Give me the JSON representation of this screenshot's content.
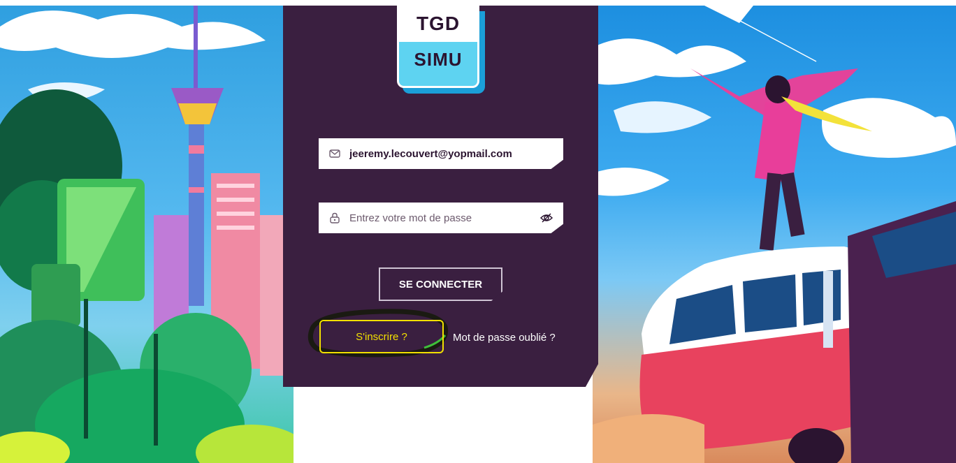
{
  "logo": {
    "top_text": "TGD",
    "brand_text": "SIMU"
  },
  "email_field": {
    "value": "jeeremy.lecouvert@yopmail.com",
    "icon": "mail-icon"
  },
  "password_field": {
    "placeholder": "Entrez votre mot de passe",
    "icon": "lock-icon",
    "toggle_icon": "eye-off-icon"
  },
  "connect_button": {
    "label": "SE CONNECTER"
  },
  "signup_button": {
    "label": "S'inscrire ?"
  },
  "forgot_link": {
    "label": "Mot de passe oublié ?"
  },
  "colors": {
    "panel": "#3a1f40",
    "logo_accent": "#5ed3f1",
    "signup_accent": "#f2e000"
  }
}
